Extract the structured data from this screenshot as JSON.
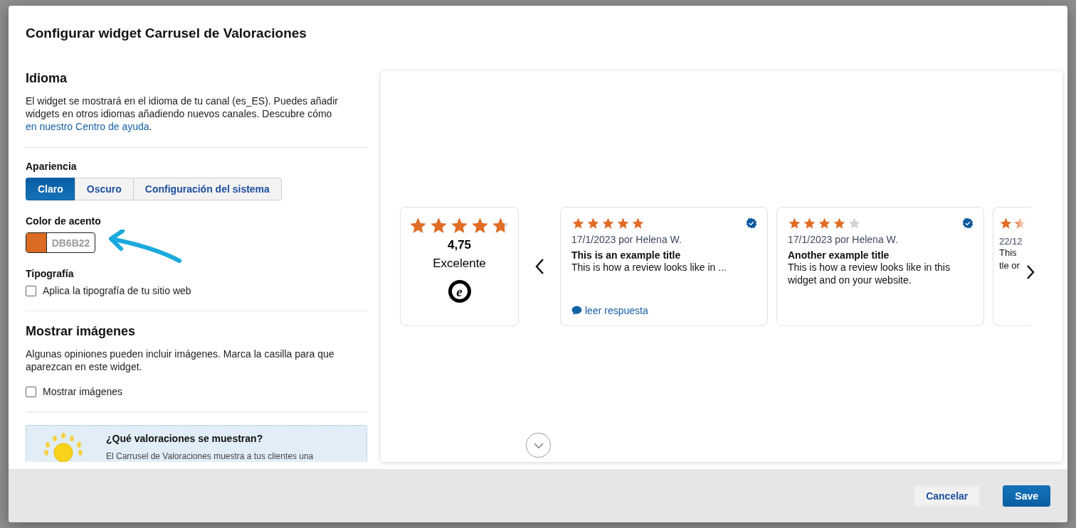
{
  "dialog": {
    "title": "Configurar widget Carrusel de Valoraciones"
  },
  "language": {
    "heading": "Idioma",
    "text": "El widget se mostrará en el idioma de tu canal (es_ES). Puedes añadir widgets en otros idiomas añadiendo nuevos canales. Descubre cómo ",
    "link": "en nuestro Centro de ayuda",
    "after_link": "."
  },
  "appearance": {
    "label": "Apariencia",
    "options": [
      {
        "label": "Claro",
        "selected": true
      },
      {
        "label": "Oscuro",
        "selected": false
      },
      {
        "label": "Configuración del sistema",
        "selected": false
      }
    ]
  },
  "accent_color": {
    "label": "Color de acento",
    "value": "DB6B22"
  },
  "typography": {
    "label": "Tipografía",
    "checkbox": {
      "label": "Aplica la tipografía de tu sitio web",
      "checked": false
    }
  },
  "images": {
    "heading": "Mostrar imágenes",
    "text": "Algunas opiniones pueden incluir imágenes. Marca la casilla para que aparezcan en este widget.",
    "checkbox": {
      "label": "Mostrar imágenes",
      "checked": false
    }
  },
  "info_box": {
    "title": "¿Qué valoraciones se muestran?",
    "text": "El Carrusel de Valoraciones muestra a tus clientes una"
  },
  "preview": {
    "summary": {
      "stars": 4.75,
      "score": "4,75",
      "rating_label": "Excelente",
      "logo_letter": "e"
    },
    "reviews": [
      {
        "stars": 5,
        "meta": "17/1/2023 por Helena W.",
        "verified": true,
        "title": "This is an example title",
        "body": [
          "This is how a review looks like in ..."
        ],
        "reply_link": "leer respuesta"
      },
      {
        "stars": 4,
        "meta": "17/1/2023 por Helena W.",
        "verified": true,
        "title": "Another example title",
        "body": [
          "This is how a review looks like in this",
          "widget and on your website."
        ]
      },
      {
        "meta": "22/12",
        "verified": false,
        "body": [
          "This",
          "tle or"
        ]
      }
    ]
  },
  "footer": {
    "buttons": [
      {
        "label": "Cancelar",
        "kind": "secondary"
      },
      {
        "label": "Save",
        "kind": "primary"
      }
    ]
  }
}
